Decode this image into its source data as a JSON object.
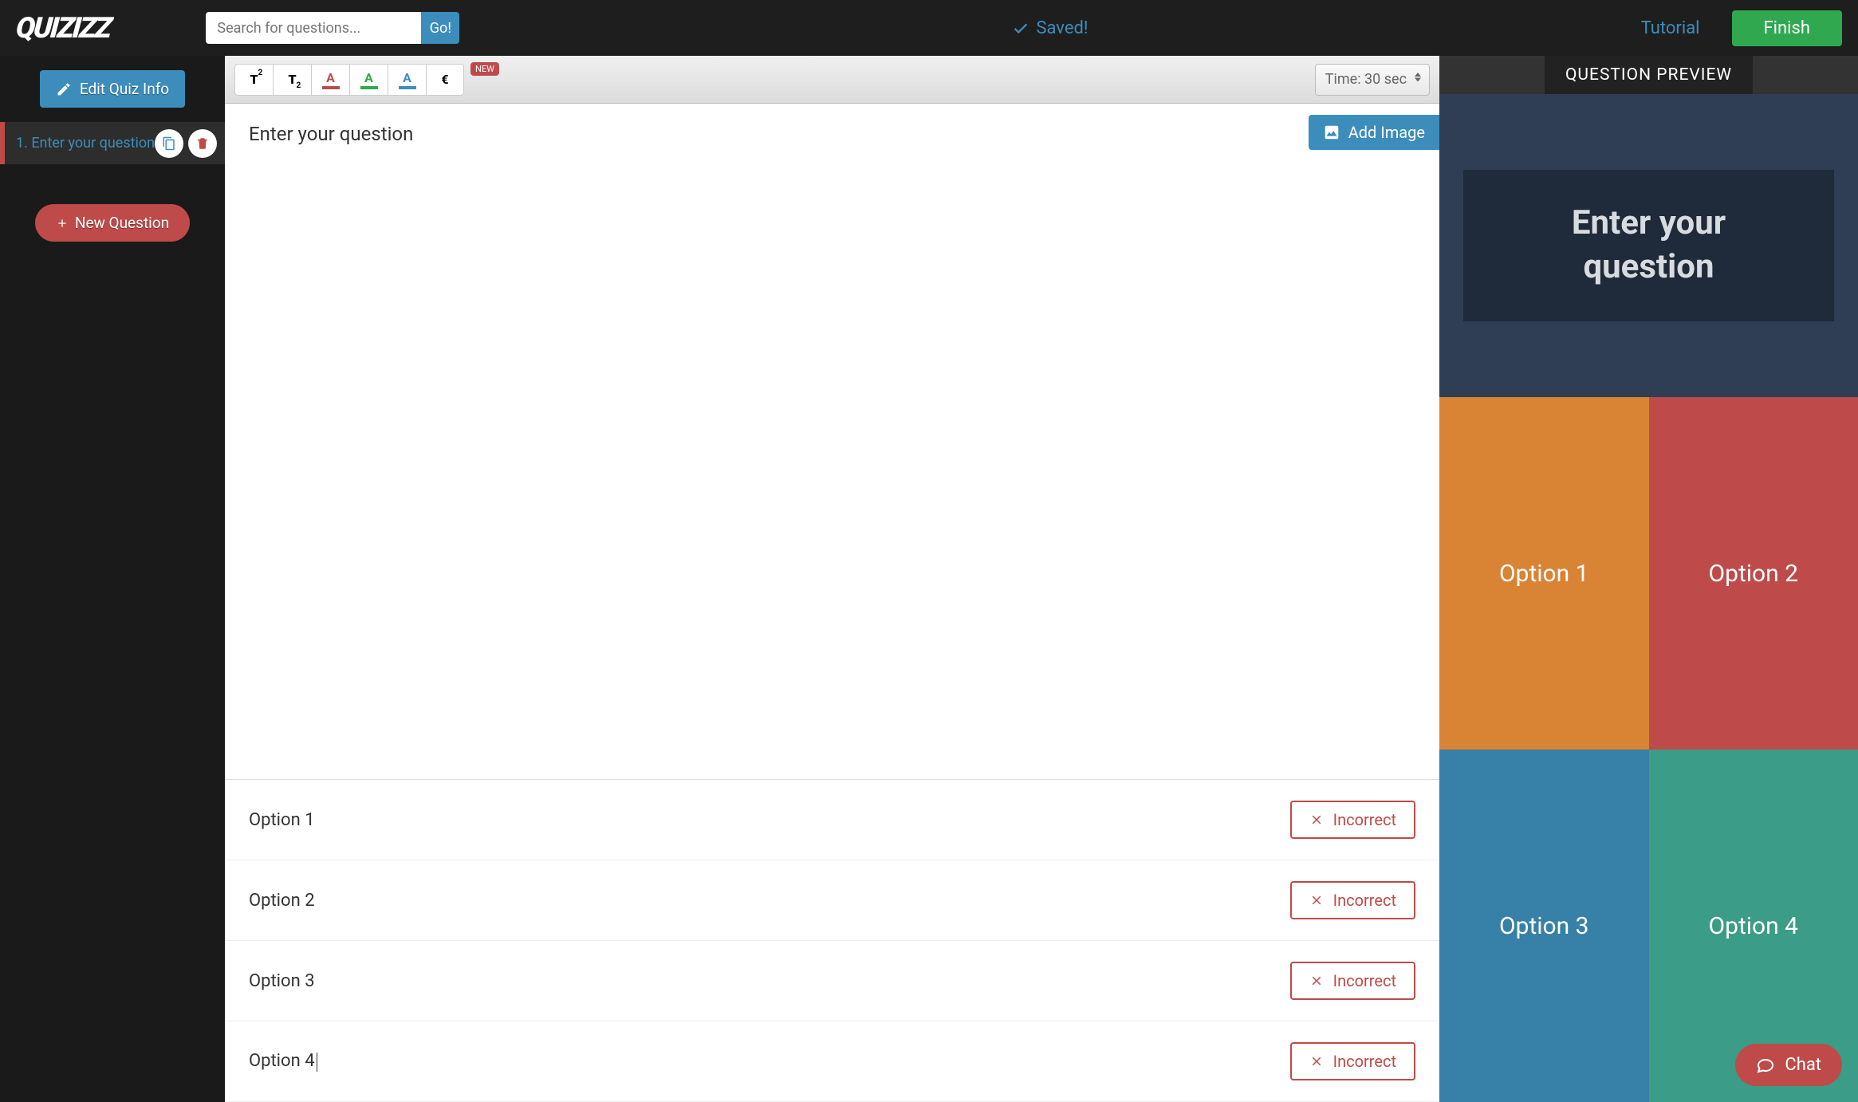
{
  "header": {
    "logo": "QUIZIZZ",
    "search_placeholder": "Search for questions...",
    "go_label": "Go!",
    "saved_label": "Saved!",
    "tutorial_label": "Tutorial",
    "finish_label": "Finish"
  },
  "sidebar": {
    "edit_quiz_label": "Edit Quiz Info",
    "question_item": "1.  Enter your question",
    "new_question_label": "New Question"
  },
  "toolbar": {
    "new_badge": "NEW",
    "time_label": "Time: 30 sec",
    "tools": {
      "superscript": "T",
      "subscript": "T",
      "color_red": "A",
      "color_green": "A",
      "color_blue": "A",
      "euro": "€"
    }
  },
  "editor": {
    "question_placeholder": "Enter your question",
    "add_image_label": "Add Image",
    "incorrect_label": "Incorrect",
    "options": [
      {
        "label": "Option 1"
      },
      {
        "label": "Option 2"
      },
      {
        "label": "Option 3"
      },
      {
        "label": "Option 4"
      }
    ]
  },
  "preview": {
    "header": "QUESTION PREVIEW",
    "question": "Enter your question",
    "options": [
      "Option 1",
      "Option 2",
      "Option 3",
      "Option 4"
    ]
  },
  "chat": {
    "label": "Chat"
  },
  "colors": {
    "option1": "#d98434",
    "option2": "#be4b49",
    "option3": "#3780a7",
    "option4": "#3b9c87"
  }
}
